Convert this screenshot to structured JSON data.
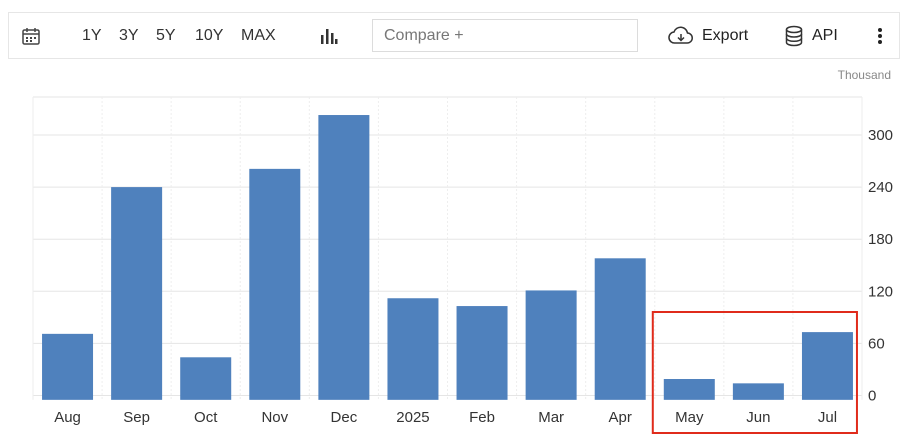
{
  "toolbar": {
    "calendar_icon": "calendar-icon",
    "ranges": [
      "1Y",
      "3Y",
      "5Y",
      "10Y",
      "MAX"
    ],
    "chart_type_icon": "bar-chart-icon",
    "compare_placeholder": "Compare +",
    "export_label": "Export",
    "export_icon": "cloud-download-icon",
    "api_label": "API",
    "api_icon": "database-icon",
    "more_icon": "more-vertical-icon"
  },
  "unit_label": "Thousand",
  "colors": {
    "bar": "#4f81bd",
    "highlight_box": "#e02b1b",
    "grid": "#e5e5e5"
  },
  "chart_data": {
    "type": "bar",
    "categories": [
      "Aug",
      "Sep",
      "Oct",
      "Nov",
      "Dec",
      "2025",
      "Feb",
      "Mar",
      "Apr",
      "May",
      "Jun",
      "Jul"
    ],
    "values": [
      71,
      240,
      44,
      261,
      323,
      112,
      103,
      121,
      158,
      19,
      14,
      73
    ],
    "yticks": [
      0,
      60,
      120,
      180,
      240,
      300
    ],
    "ylim": [
      -5,
      345
    ],
    "y_axis_position": "right",
    "grid": true,
    "highlighted_categories": [
      "May",
      "Jun",
      "Jul"
    ]
  }
}
